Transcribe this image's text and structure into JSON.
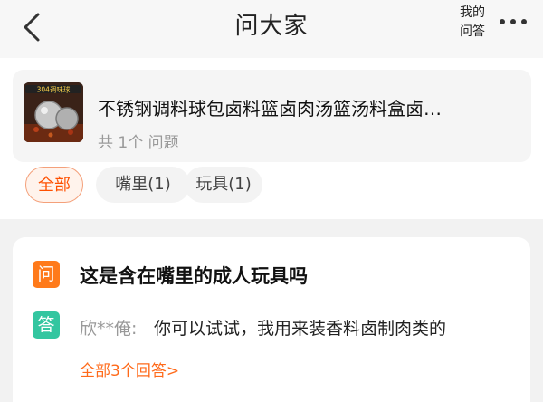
{
  "header": {
    "title": "问大家",
    "my_qa_line1": "我的",
    "my_qa_line2": "问答"
  },
  "product": {
    "thumb_badge": "304调味球",
    "title": "不锈钢调料球包卤料篮卤肉汤篮汤料盒卤…",
    "question_count": "共 1个 问题"
  },
  "tags": [
    {
      "label": "全部",
      "active": true
    },
    {
      "label": "嘴里(1)",
      "active": false
    },
    {
      "label": "玩具(1)",
      "active": false
    }
  ],
  "qa": {
    "question_badge": "问",
    "question": "这是含在嘴里的成人玩具吗",
    "answer_badge": "答",
    "answer_user": "欣**俺:",
    "answer": "你可以试试，我用来装香料卤制肉类的",
    "all_answers": "全部3个回答>"
  },
  "colors": {
    "accent": "#ff5000",
    "question_badge": "#ff7a1a",
    "answer_badge": "#33c6a0"
  }
}
